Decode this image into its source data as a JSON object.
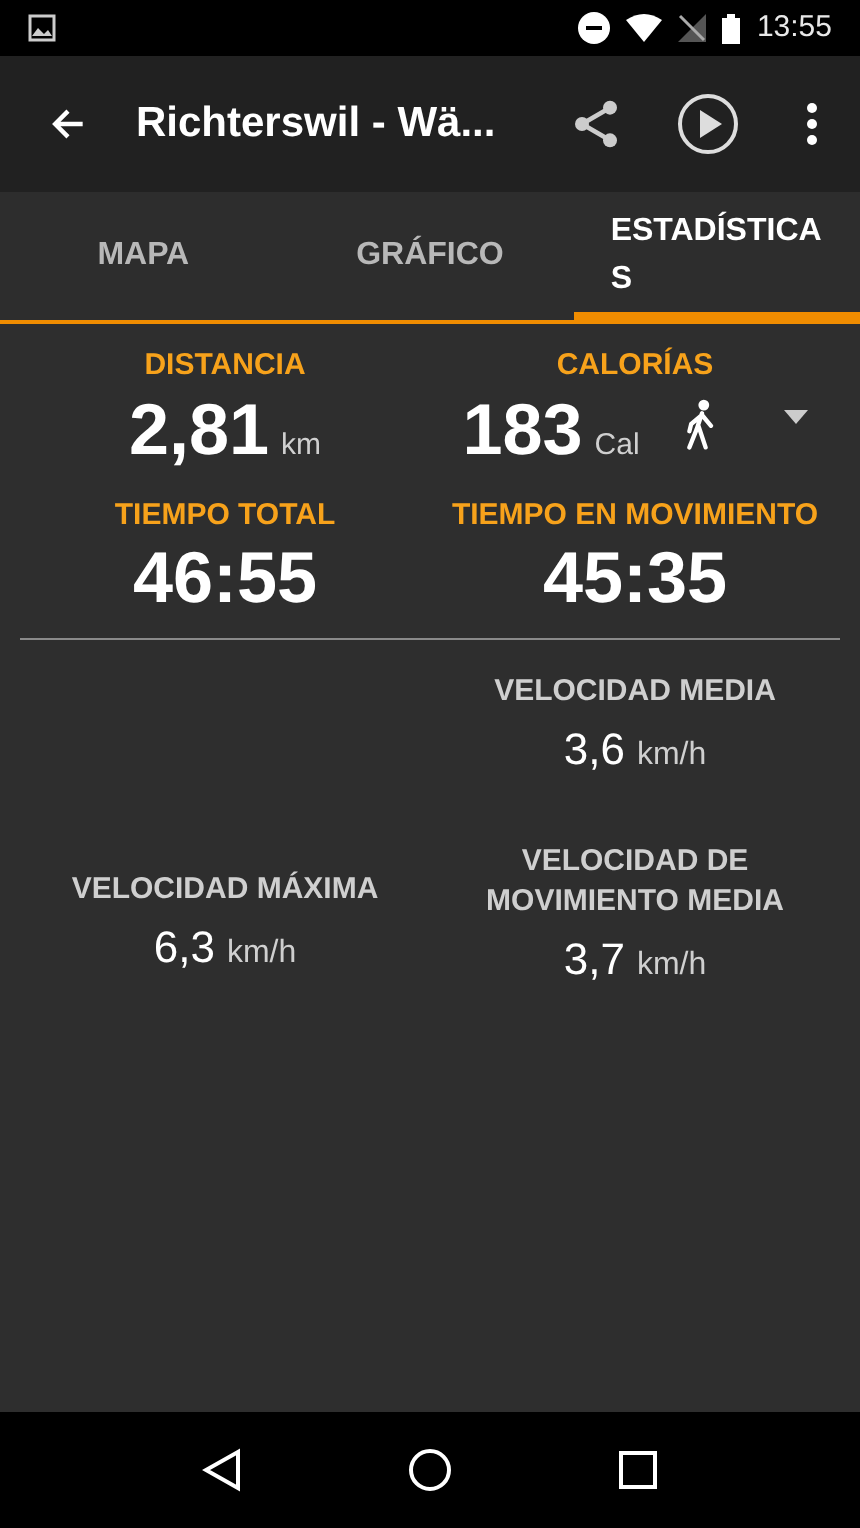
{
  "status_bar": {
    "time": "13:55"
  },
  "app_bar": {
    "title": "Richterswil - Wä..."
  },
  "tabs": [
    {
      "label": "MAPA",
      "selected": false
    },
    {
      "label": "GRÁFICO",
      "selected": false
    },
    {
      "label": "ESTADÍSTICAS",
      "selected": true
    }
  ],
  "main_stats": [
    {
      "label": "DISTANCIA",
      "value": "2,81",
      "unit": "km"
    },
    {
      "label": "CALORÍAS",
      "value": "183",
      "unit": "Cal",
      "activity_selector": true
    },
    {
      "label": "TIEMPO TOTAL",
      "value": "46:55"
    },
    {
      "label": "TIEMPO EN MOVIMIENTO",
      "value": "45:35"
    }
  ],
  "speed_stats": [
    {
      "label": "VELOCIDAD MEDIA",
      "value": "3,6",
      "unit": "km/h"
    },
    {
      "label": "VELOCIDAD MÁXIMA",
      "value": "6,3",
      "unit": "km/h"
    },
    {
      "label": "VELOCIDAD DE MOVIMIENTO MEDIA",
      "value": "3,7",
      "unit": "km/h"
    }
  ]
}
